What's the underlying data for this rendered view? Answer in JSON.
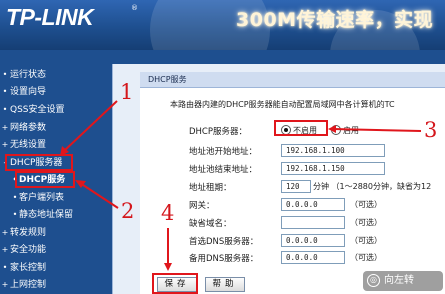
{
  "banner": {
    "logo": "TP-LINK",
    "logo_mark": "®",
    "slogan": "300M传输速率，实现"
  },
  "sidebar": {
    "items": [
      {
        "label": "运行状态",
        "bullet": "•"
      },
      {
        "label": "设置向导",
        "bullet": "•"
      },
      {
        "label": "QSS安全设置",
        "bullet": "•"
      },
      {
        "label": "网络参数",
        "bullet": "+"
      },
      {
        "label": "无线设置",
        "bullet": "+"
      },
      {
        "label": "DHCP服务器",
        "bullet": "-"
      },
      {
        "label": "DHCP服务",
        "bullet": "•"
      },
      {
        "label": "客户端列表",
        "bullet": "•"
      },
      {
        "label": "静态地址保留",
        "bullet": "•"
      },
      {
        "label": "转发规则",
        "bullet": "+"
      },
      {
        "label": "安全功能",
        "bullet": "+"
      },
      {
        "label": "家长控制",
        "bullet": "•"
      },
      {
        "label": "上网控制",
        "bullet": "+"
      }
    ]
  },
  "panel": {
    "title": "DHCP服务",
    "description": "本路由器内建的DHCP服务器能自动配置局域网中各计算机的TC",
    "fields": {
      "server_label": "DHCP服务器：",
      "option_disable": "不启用",
      "option_enable": "启用",
      "selected": "不启用",
      "start_label": "地址池开始地址：",
      "start_value": "192.168.1.100",
      "end_label": "地址池结束地址：",
      "end_value": "192.168.1.150",
      "lease_label": "地址租期：",
      "lease_value": "120",
      "lease_note": "分钟 （1～2880分钟，缺省为12",
      "gateway_label": "网关：",
      "gateway_value": "0.0.0.0",
      "domain_label": "缺省域名：",
      "domain_value": "",
      "dns1_label": "首选DNS服务器：",
      "dns1_value": "0.0.0.0",
      "dns2_label": "备用DNS服务器：",
      "dns2_value": "0.0.0.0",
      "optional": "（可选）"
    },
    "buttons": {
      "save": "保存",
      "help": "帮助"
    }
  },
  "annotations": {
    "n1": "1",
    "n2": "2",
    "n3": "3",
    "n4": "4",
    "color": "#e0161c"
  },
  "watermark": {
    "icon": "◎",
    "text": "向左转"
  }
}
